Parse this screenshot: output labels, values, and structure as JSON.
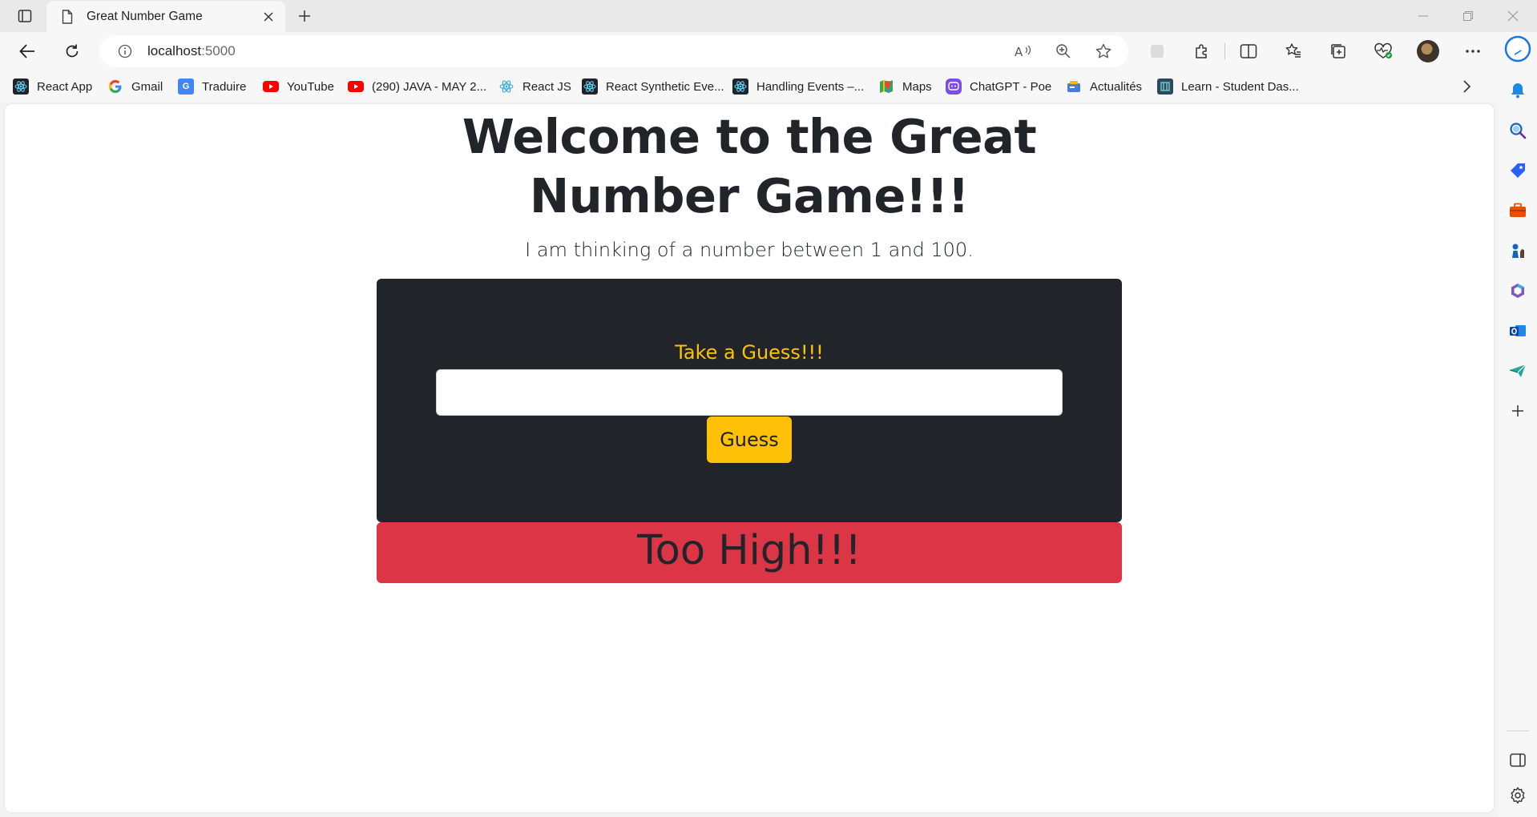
{
  "browser": {
    "tab_title": "Great Number Game",
    "url_host": "localhost",
    "url_port": ":5000"
  },
  "bookmarks": [
    {
      "label": "React App",
      "icon": "react-icon"
    },
    {
      "label": "Gmail",
      "icon": "google-icon"
    },
    {
      "label": "Traduire",
      "icon": "translate-icon"
    },
    {
      "label": "YouTube",
      "icon": "youtube-icon"
    },
    {
      "label": "(290) JAVA - MAY 2...",
      "icon": "youtube-icon"
    },
    {
      "label": "React JS",
      "icon": "react-icon"
    },
    {
      "label": "React Synthetic Eve...",
      "icon": "react-icon"
    },
    {
      "label": "Handling Events –...",
      "icon": "react-icon"
    },
    {
      "label": "Maps",
      "icon": "maps-icon"
    },
    {
      "label": "ChatGPT - Poe",
      "icon": "poe-icon"
    },
    {
      "label": "Actualités",
      "icon": "news-icon"
    },
    {
      "label": "Learn - Student Das...",
      "icon": "learn-icon"
    }
  ],
  "page": {
    "heading": "Welcome to the Great Number Game!!!",
    "lead": "I am thinking of a number between 1 and 100.",
    "guess_label": "Take a Guess!!!",
    "guess_value": "",
    "guess_button": "Guess",
    "result_text": "Too High!!!"
  },
  "colors": {
    "card_bg": "#212529",
    "accent_yellow": "#ffc107",
    "result_red": "#dc3545",
    "text_dark": "#212529"
  }
}
